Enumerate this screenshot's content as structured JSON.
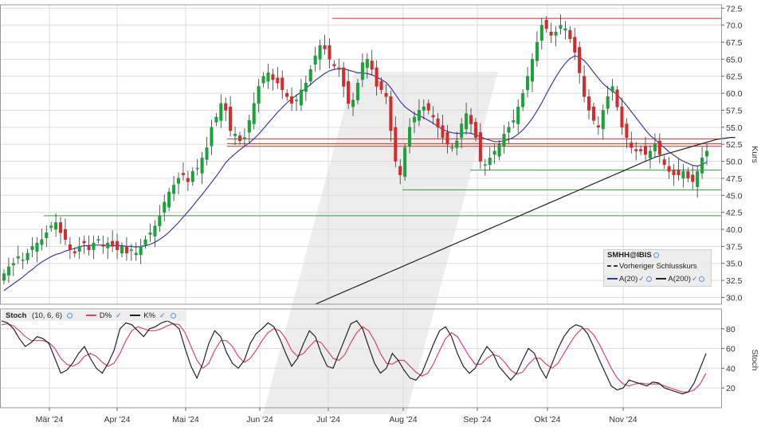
{
  "chart_data": [
    {
      "type": "candlestick",
      "symbol": "SMHH@IBIS",
      "y_axis_title": "Kurs",
      "y_ticks": [
        "72.5",
        "70.0",
        "67.5",
        "65.0",
        "62.5",
        "60.0",
        "57.5",
        "55.0",
        "52.5",
        "50.0",
        "47.5",
        "45.0",
        "42.5",
        "40.0",
        "37.5",
        "35.0",
        "32.5",
        "30.0"
      ],
      "ylim": [
        29,
        73
      ],
      "x_labels": [
        "Mär '24",
        "Apr '24",
        "Mai '24",
        "Jun '24",
        "Jul '24",
        "Aug '24",
        "Sep '24",
        "Okt '24",
        "Nov '24"
      ],
      "legend": {
        "title": "SMHH@IBIS",
        "prev_close": "Vorheriger Schlusskurs",
        "ma20": "A(20)",
        "ma200": "A(200)"
      },
      "colors": {
        "up": "#1aa33a",
        "down": "#d62b2b",
        "ma20": "#3c3ca8",
        "ma200": "#222222",
        "hline_red": "#c0392b",
        "hline_green": "#3a9a3a"
      },
      "resistance_red": [
        71.0,
        53.3,
        52.6,
        52.2
      ],
      "support_green": [
        48.7,
        45.8,
        42.0
      ],
      "closes": [
        33.5,
        34.5,
        35.0,
        36.0,
        35.5,
        36.5,
        37.5,
        38.0,
        38.5,
        39.5,
        40.5,
        41.0,
        39.5,
        38.5,
        37.0,
        36.5,
        37.5,
        38.0,
        37.0,
        38.0,
        38.5,
        37.5,
        38.0,
        37.5,
        37.0,
        37.5,
        36.5,
        37.0,
        36.5,
        37.5,
        38.5,
        39.5,
        40.5,
        42.0,
        44.0,
        45.5,
        46.5,
        47.5,
        48.0,
        47.0,
        48.5,
        49.0,
        50.5,
        52.0,
        55.0,
        56.5,
        58.5,
        57.5,
        54.5,
        54.0,
        53.0,
        53.5,
        56.0,
        58.5,
        61.0,
        62.5,
        63.0,
        62.0,
        61.5,
        60.5,
        59.5,
        58.5,
        59.0,
        60.5,
        61.5,
        63.5,
        65.5,
        67.0,
        66.5,
        65.0,
        64.0,
        63.5,
        61.0,
        58.5,
        59.0,
        61.5,
        64.5,
        65.0,
        63.5,
        61.0,
        60.5,
        59.5,
        54.5,
        50.0,
        48.0,
        52.0,
        55.0,
        56.5,
        57.5,
        58.0,
        57.5,
        56.5,
        55.0,
        53.5,
        52.5,
        52.0,
        53.0,
        55.5,
        57.0,
        55.5,
        53.5,
        50.0,
        49.5,
        50.5,
        51.5,
        52.5,
        54.0,
        55.0,
        56.0,
        58.0,
        60.0,
        62.5,
        65.0,
        67.5,
        70.0,
        69.5,
        68.5,
        69.0,
        70.0,
        69.5,
        68.0,
        66.0,
        63.0,
        59.5,
        57.5,
        56.0,
        55.0,
        57.5,
        59.5,
        61.0,
        58.0,
        55.0,
        53.5,
        52.0,
        51.5,
        51.5,
        51.0,
        51.5,
        52.5,
        51.0,
        49.5,
        48.5,
        48.0,
        48.0,
        48.5,
        47.5,
        47.0,
        48.5,
        50.5,
        51.5
      ],
      "ma20": [
        31.0,
        31.5,
        32.0,
        32.5,
        33.0,
        33.6,
        34.1,
        34.7,
        35.2,
        35.6,
        36.0,
        36.3,
        36.5,
        36.8,
        37.0,
        37.2,
        37.4,
        37.6,
        37.6,
        37.7,
        37.7,
        37.7,
        37.6,
        37.6,
        37.6,
        37.6,
        37.5,
        37.5,
        37.4,
        37.5,
        37.6,
        37.8,
        38.1,
        38.5,
        39.0,
        39.6,
        40.3,
        41.0,
        41.8,
        42.6,
        43.4,
        44.3,
        45.1,
        46.0,
        46.9,
        47.8,
        48.8,
        49.8,
        50.5,
        51.1,
        51.7,
        52.2,
        52.7,
        53.3,
        54.0,
        54.8,
        55.6,
        56.4,
        57.2,
        57.9,
        58.6,
        59.2,
        59.7,
        60.2,
        60.7,
        61.3,
        61.9,
        62.4,
        62.9,
        63.3,
        63.5,
        63.6,
        63.6,
        63.4,
        63.2,
        63.0,
        63.0,
        62.9,
        62.7,
        62.4,
        62.0,
        61.6,
        60.8,
        59.8,
        58.8,
        58.0,
        57.5,
        57.0,
        56.7,
        56.4,
        56.0,
        55.6,
        55.1,
        54.7,
        54.4,
        54.2,
        54.1,
        54.1,
        54.2,
        54.1,
        53.9,
        53.6,
        53.3,
        53.1,
        52.9,
        52.9,
        53.0,
        53.2,
        53.5,
        54.0,
        54.6,
        55.4,
        56.3,
        57.4,
        58.6,
        59.9,
        61.2,
        62.4,
        63.5,
        64.4,
        65.1,
        65.5,
        65.3,
        64.8,
        64.0,
        63.1,
        62.2,
        61.4,
        60.8,
        60.3,
        59.8,
        59.0,
        58.2,
        57.3,
        56.4,
        55.5,
        54.6,
        53.8,
        53.2,
        52.6,
        52.0,
        51.4,
        50.9,
        50.4,
        50.0,
        49.7,
        49.4,
        49.3,
        49.5,
        49.9
      ],
      "ma200": [
        null,
        null,
        null,
        null,
        null,
        null,
        null,
        null,
        null,
        null,
        null,
        null,
        null,
        null,
        null,
        null,
        null,
        null,
        null,
        null,
        null,
        null,
        null,
        null,
        null,
        null,
        null,
        null,
        null,
        null,
        null,
        null,
        null,
        null,
        null,
        null,
        null,
        null,
        null,
        null,
        null,
        null,
        null,
        null,
        null,
        null,
        null,
        null,
        null,
        null,
        null,
        null,
        null,
        null,
        null,
        null,
        null,
        null,
        null,
        null,
        null,
        null,
        null,
        null,
        null,
        null,
        29.0,
        29.3,
        29.6,
        29.9,
        30.2,
        30.5,
        30.8,
        31.1,
        31.4,
        31.7,
        32.0,
        32.3,
        32.6,
        32.9,
        33.2,
        33.5,
        33.8,
        34.1,
        34.4,
        34.7,
        35.0,
        35.3,
        35.6,
        35.9,
        36.2,
        36.5,
        36.8,
        37.1,
        37.4,
        37.7,
        38.0,
        38.3,
        38.6,
        38.9,
        39.2,
        39.5,
        39.8,
        40.1,
        40.4,
        40.7,
        41.0,
        41.3,
        41.6,
        41.9,
        42.2,
        42.5,
        42.8,
        43.1,
        43.4,
        43.7,
        44.0,
        44.3,
        44.6,
        44.9,
        45.2,
        45.5,
        45.8,
        46.1,
        46.4,
        46.7,
        47.0,
        47.3,
        47.6,
        47.9,
        48.2,
        48.5,
        48.8,
        49.1,
        49.4,
        49.7,
        50.0,
        50.3,
        50.6,
        50.8,
        51.0,
        51.2,
        51.4,
        51.6,
        51.8,
        52.0,
        52.2,
        52.4,
        52.6,
        52.8,
        53.0,
        53.2,
        53.3,
        53.4,
        53.5,
        53.5
      ]
    },
    {
      "type": "line",
      "name": "Stoch",
      "params": "(10, 6, 6)",
      "y_axis_title": "Stoch",
      "y_ticks": [
        "80",
        "60",
        "40",
        "20"
      ],
      "ylim": [
        0,
        100
      ],
      "series": [
        {
          "name": "D%",
          "color": "#d9456a"
        },
        {
          "name": "K%",
          "color": "#222222"
        }
      ],
      "k": [
        88,
        86,
        80,
        70,
        62,
        66,
        72,
        70,
        65,
        50,
        35,
        38,
        45,
        55,
        62,
        50,
        40,
        35,
        45,
        58,
        80,
        86,
        84,
        78,
        72,
        80,
        82,
        86,
        88,
        85,
        80,
        60,
        42,
        30,
        45,
        65,
        78,
        72,
        56,
        45,
        40,
        48,
        65,
        75,
        80,
        86,
        82,
        70,
        55,
        42,
        50,
        65,
        78,
        72,
        55,
        42,
        40,
        55,
        70,
        85,
        88,
        80,
        62,
        45,
        35,
        40,
        55,
        48,
        38,
        30,
        28,
        35,
        50,
        65,
        78,
        82,
        72,
        55,
        42,
        35,
        40,
        52,
        62,
        55,
        42,
        35,
        28,
        35,
        48,
        60,
        55,
        40,
        30,
        45,
        60,
        72,
        80,
        84,
        82,
        75,
        62,
        48,
        35,
        22,
        18,
        20,
        28,
        26,
        24,
        22,
        26,
        25,
        20,
        18,
        16,
        14,
        16,
        25,
        40,
        55
      ],
      "d": [
        84,
        85,
        83,
        78,
        72,
        68,
        68,
        68,
        66,
        60,
        50,
        44,
        42,
        45,
        52,
        55,
        52,
        46,
        42,
        45,
        55,
        68,
        78,
        82,
        80,
        78,
        78,
        80,
        83,
        85,
        84,
        76,
        62,
        48,
        40,
        45,
        58,
        68,
        68,
        62,
        52,
        46,
        50,
        58,
        68,
        76,
        80,
        78,
        70,
        58,
        52,
        55,
        62,
        68,
        66,
        58,
        50,
        48,
        54,
        66,
        76,
        82,
        78,
        68,
        55,
        45,
        44,
        48,
        48,
        42,
        36,
        32,
        35,
        45,
        58,
        70,
        76,
        72,
        62,
        52,
        44,
        44,
        50,
        54,
        52,
        46,
        38,
        34,
        36,
        44,
        50,
        50,
        44,
        40,
        45,
        55,
        65,
        74,
        80,
        80,
        74,
        64,
        52,
        40,
        30,
        24,
        22,
        24,
        25,
        24,
        24,
        24,
        22,
        20,
        18,
        16,
        16,
        18,
        24,
        35
      ]
    }
  ]
}
